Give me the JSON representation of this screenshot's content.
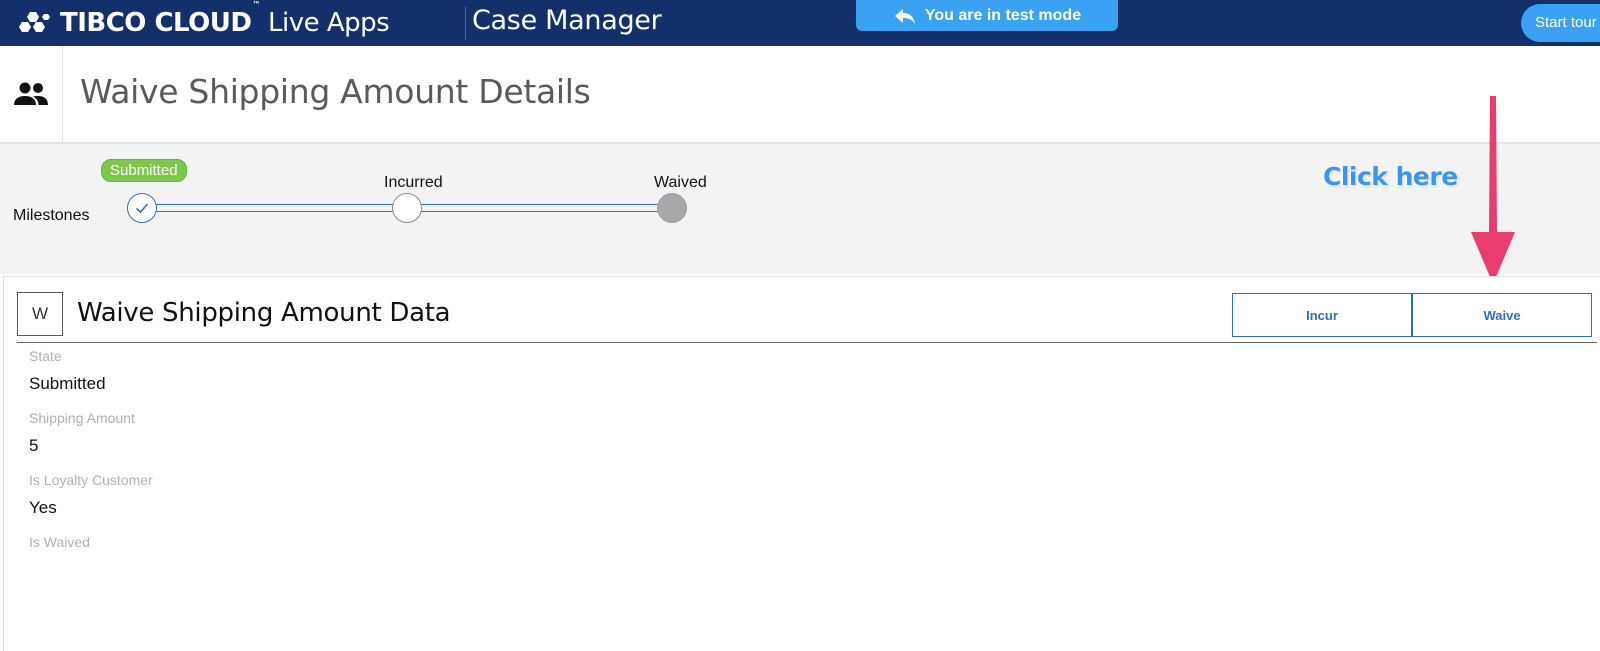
{
  "topbar": {
    "brand_name": "TIBCO CLOUD",
    "brand_tm": "™",
    "brand_app": "Live Apps",
    "section": "Case Manager",
    "test_mode": "You are in test mode",
    "start_tour": "Start tour"
  },
  "header": {
    "title": "Waive Shipping Amount Details"
  },
  "milestones": {
    "label": "Milestones",
    "current_badge": "Submitted",
    "steps": [
      "Submitted",
      "Incurred",
      "Waived"
    ]
  },
  "annotation": {
    "text": "Click here",
    "color": "#3b95ea",
    "arrow_color": "#ea3c6e"
  },
  "panel": {
    "icon_letter": "W",
    "title": "Waive Shipping Amount Data",
    "actions": [
      "Incur",
      "Waive"
    ],
    "fields": [
      {
        "label": "State",
        "value": "Submitted"
      },
      {
        "label": "Shipping Amount",
        "value": "5"
      },
      {
        "label": "Is Loyalty Customer",
        "value": "Yes"
      },
      {
        "label": "Is Waived",
        "value": ""
      }
    ]
  },
  "colors": {
    "topbar": "#13306b",
    "accent": "#3ba1f2",
    "primary_link": "#2f6fb8",
    "badge_green": "#7cc84b"
  }
}
